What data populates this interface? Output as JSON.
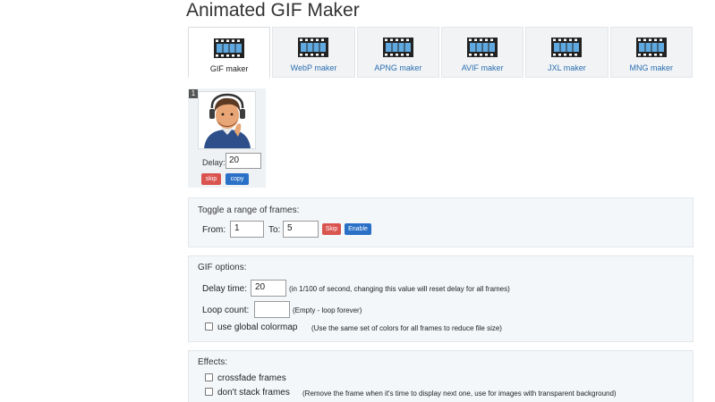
{
  "page": {
    "title": "Animated GIF Maker"
  },
  "tabs": [
    {
      "label": "GIF maker",
      "active": true
    },
    {
      "label": "WebP maker",
      "active": false
    },
    {
      "label": "APNG maker",
      "active": false
    },
    {
      "label": "AVIF maker",
      "active": false
    },
    {
      "label": "JXL maker",
      "active": false
    },
    {
      "label": "MNG maker",
      "active": false
    }
  ],
  "frame": {
    "number": "1",
    "delay_label": "Delay:",
    "delay_value": "20",
    "skip_label": "skip",
    "copy_label": "copy"
  },
  "range": {
    "title": "Toggle a range of frames:",
    "from_label": "From:",
    "from_value": "1",
    "to_label": "To:",
    "to_value": "5",
    "skip_label": "Skip",
    "enable_label": "Enable"
  },
  "gif_options": {
    "title": "GIF options:",
    "delay_label": "Delay time:",
    "delay_value": "20",
    "delay_note": "(in 1/100 of second, changing this value will reset delay for all frames)",
    "loop_label": "Loop count:",
    "loop_value": "",
    "loop_note": "(Empty - loop forever)",
    "colormap_label": "use global colormap",
    "colormap_note": "(Use the same set of colors for all frames to reduce file size)"
  },
  "effects": {
    "title": "Effects:",
    "crossfade_label": "crossfade frames",
    "nostack_label": "don't stack frames",
    "nostack_note": "(Remove the frame when it's time to display next one, use for images with transparent background)"
  },
  "icons": {
    "tab_icon": "film-strip-icon"
  },
  "colors": {
    "link": "#2b6fb0",
    "skip": "#d9534f",
    "copy": "#2a70c7",
    "panel": "#f4f7fa"
  }
}
